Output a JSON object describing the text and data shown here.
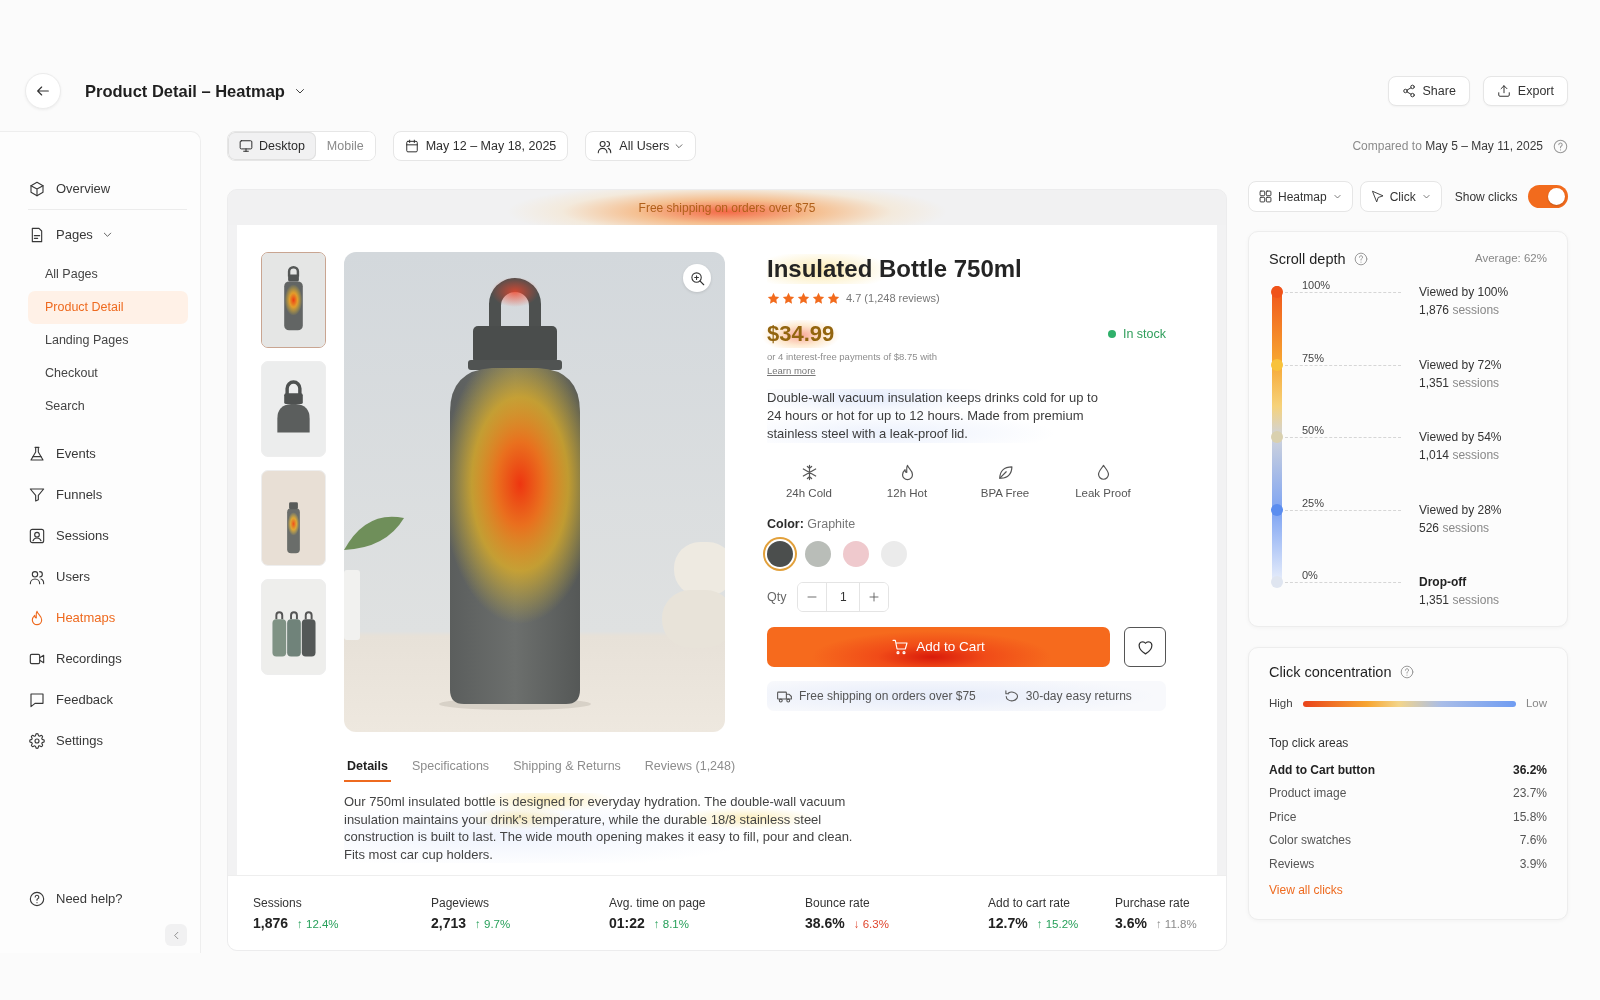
{
  "header": {
    "title": "Product Detail – Heatmap",
    "actions": [
      {
        "label": "Share"
      },
      {
        "label": "Export"
      }
    ]
  },
  "sidebar": {
    "items": [
      {
        "label": "Overview",
        "selected": false
      },
      {
        "label": "Pages",
        "selected": false,
        "expanded": true,
        "children": [
          {
            "label": "All Pages",
            "selected": false
          },
          {
            "label": "Product Detail",
            "selected": true
          },
          {
            "label": "Landing Pages",
            "selected": false
          },
          {
            "label": "Checkout",
            "selected": false
          },
          {
            "label": "Search",
            "selected": false
          }
        ]
      },
      {
        "label": "Events",
        "selected": false
      },
      {
        "label": "Funnels",
        "selected": false
      },
      {
        "label": "Sessions",
        "selected": false
      },
      {
        "label": "Users",
        "selected": false
      },
      {
        "label": "Heatmaps",
        "selected": true
      },
      {
        "label": "Recordings",
        "selected": false
      },
      {
        "label": "Feedback",
        "selected": false
      },
      {
        "label": "Settings",
        "selected": false
      }
    ],
    "help": "Need help?"
  },
  "toolbar": {
    "devices": [
      {
        "kind": "desktop",
        "label": "Desktop",
        "selected": true
      },
      {
        "kind": "mobile",
        "label": "Mobile",
        "selected": false
      }
    ],
    "date_range": "May 12 – May 18, 2025",
    "audience": "All Users",
    "comparison": {
      "label": "Compared to",
      "range": "May 5 – May 11, 2025"
    }
  },
  "preview": {
    "banner": "Free shipping on orders over $75",
    "thumbnails": [
      {
        "selected": true
      },
      {
        "selected": false
      },
      {
        "selected": false
      },
      {
        "selected": false
      }
    ],
    "product": {
      "title": "Insulated Bottle 750ml",
      "stars": 5,
      "rating": "4.7 (1,248 reviews)",
      "price": "$34.99",
      "stock": "In stock",
      "installments": "or 4 interest-free payments of $8.75 with",
      "installments_link": "Learn more",
      "description": "Double-wall vacuum insulation keeps drinks cold for up to 24 hours or hot for up to 12 hours. Made from premium stainless steel with a leak-proof lid.",
      "features": [
        {
          "label": "24h Cold"
        },
        {
          "label": "12h Hot"
        },
        {
          "label": "BPA Free"
        },
        {
          "label": "Leak Proof"
        }
      ],
      "color_label": "Color:",
      "color_value": "Graphite",
      "swatches": [
        {
          "color": "#4b4e4d",
          "selected": true
        },
        {
          "color": "#b9bdb8",
          "selected": false
        },
        {
          "color": "#efc9cd",
          "selected": false
        },
        {
          "color": "#ebebeb",
          "selected": false
        }
      ],
      "quantity_label": "Qty",
      "quantity": "1",
      "add_to_cart": "Add to Cart",
      "perks": [
        {
          "label": "Free shipping on orders over $75"
        },
        {
          "label": "30-day easy returns"
        }
      ]
    },
    "tabs": [
      {
        "label": "Details",
        "selected": true
      },
      {
        "label": "Specifications",
        "selected": false
      },
      {
        "label": "Shipping & Returns",
        "selected": false
      },
      {
        "label": "Reviews (1,248)",
        "selected": false
      }
    ],
    "details": "Our 750ml insulated bottle is designed for everyday hydration. The double-wall vacuum insulation maintains your drink's temperature, while the durable 18/8 stainless steel construction is built to last. The wide mouth opening makes it easy to fill, pour and clean. Fits most car cup holders.",
    "metrics": [
      {
        "label": "Sessions",
        "value": "1,876",
        "delta": "↑ 12.4%",
        "kind": "positive"
      },
      {
        "label": "Pageviews",
        "value": "2,713",
        "delta": "↑ 9.7%",
        "kind": "positive"
      },
      {
        "label": "Avg. time on page",
        "value": "01:22",
        "delta": "↑ 8.1%",
        "kind": "positive"
      },
      {
        "label": "Bounce rate",
        "value": "38.6%",
        "delta": "↓ 6.3%",
        "kind": "negative"
      },
      {
        "label": "Add to cart rate",
        "value": "12.7%",
        "delta": "↑ 15.2%",
        "kind": "positive"
      },
      {
        "label": "Purchase rate",
        "value": "3.6%",
        "delta": "↑ 11.8%",
        "kind": "neutral"
      }
    ]
  },
  "panel": {
    "view_mode": "Heatmap",
    "interaction": "Click",
    "show_clicks": {
      "label": "Show clicks",
      "on": true
    },
    "scroll_depth": {
      "title": "Scroll depth",
      "average": "Average: 62%",
      "levels": [
        {
          "kind": "viewed",
          "label": "100%",
          "color": "#f0531a",
          "title": "Viewed by 100%",
          "count": "1,876",
          "unit": "sessions"
        },
        {
          "kind": "viewed",
          "label": "75%",
          "color": "#f8c23a",
          "title": "Viewed by 72%",
          "count": "1,351",
          "unit": "sessions"
        },
        {
          "kind": "viewed",
          "label": "50%",
          "color": "#d9d0ae",
          "title": "Viewed by 54%",
          "count": "1,014",
          "unit": "sessions"
        },
        {
          "kind": "viewed",
          "label": "25%",
          "color": "#5b8def",
          "title": "Viewed by 28%",
          "count": "526",
          "unit": "sessions"
        },
        {
          "kind": "dropoff",
          "label": "0%",
          "color": "#dfe5f0",
          "title": "Drop-off",
          "count": "1,351",
          "unit": "sessions"
        }
      ]
    },
    "click_concentration": {
      "title": "Click concentration",
      "scale_high": "High",
      "scale_low": "Low",
      "subtitle": "Top click areas",
      "areas": [
        {
          "label": "Add to Cart button",
          "value": "36.2%",
          "top": true
        },
        {
          "label": "Product image",
          "value": "23.7%",
          "top": false
        },
        {
          "label": "Price",
          "value": "15.8%",
          "top": false
        },
        {
          "label": "Color swatches",
          "value": "7.6%",
          "top": false
        },
        {
          "label": "Reviews",
          "value": "3.9%",
          "top": false
        }
      ],
      "link": "View all clicks"
    }
  }
}
